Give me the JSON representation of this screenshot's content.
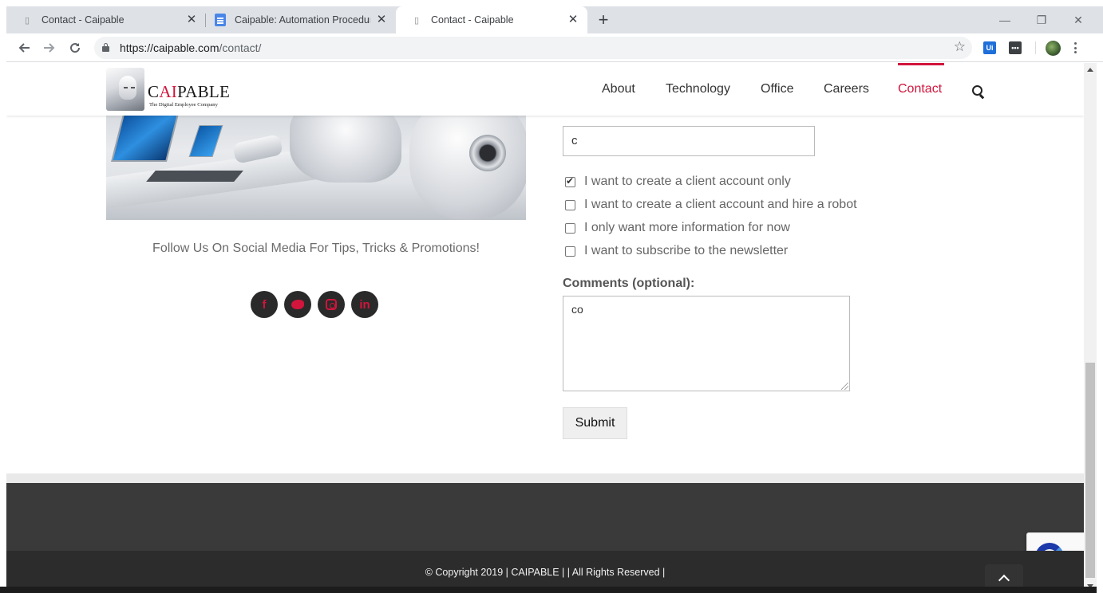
{
  "browser": {
    "tabs": [
      {
        "title": "Contact - Caipable",
        "active": false
      },
      {
        "title": "Caipable: Automation Procedure",
        "active": false
      },
      {
        "title": "Contact - Caipable",
        "active": true
      }
    ],
    "new_tab": "+",
    "close_glyph": "✕",
    "window_controls": {
      "minimize": "—",
      "restore": "❐",
      "close": "✕"
    },
    "url_host": "https://caipable.com",
    "url_path": "/contact/",
    "extensions": [
      {
        "icon": "uipath-extension-icon",
        "label": "Ui",
        "color": "#1e6fd9"
      },
      {
        "icon": "password-extension-icon",
        "label": "•••",
        "color": "#3c4043"
      }
    ]
  },
  "site": {
    "logo": {
      "prefix": "C",
      "accent": "AI",
      "suffix": "PABLE",
      "tagline": "The Digital Employee Company"
    },
    "nav": [
      {
        "label": "About",
        "active": false
      },
      {
        "label": "Technology",
        "active": false
      },
      {
        "label": "Office",
        "active": false
      },
      {
        "label": "Careers",
        "active": false
      },
      {
        "label": "Contact",
        "active": true
      }
    ],
    "accent_color": "#d1153c"
  },
  "left": {
    "follow_text": "Follow Us On Social Media For Tips, Tricks & Promotions!",
    "social": [
      {
        "icon": "facebook-icon",
        "glyph": "f"
      },
      {
        "icon": "twitter-icon",
        "glyph": ""
      },
      {
        "icon": "instagram-icon",
        "glyph": ""
      },
      {
        "icon": "linkedin-icon",
        "glyph": "in"
      }
    ]
  },
  "form": {
    "text_field_value": "c",
    "options": [
      {
        "label": "I want to create a client account only",
        "checked": true
      },
      {
        "label": "I want to create a client account and hire a robot",
        "checked": false
      },
      {
        "label": "I only want more information for now",
        "checked": false
      },
      {
        "label": "I want to subscribe to the newsletter",
        "checked": false
      }
    ],
    "comments_label": "Comments (optional):",
    "comments_value": "co",
    "submit_label": "Submit"
  },
  "footer": {
    "copyright": "© Copyright 2019 | CAIPABLE | | All Rights Reserved |"
  }
}
